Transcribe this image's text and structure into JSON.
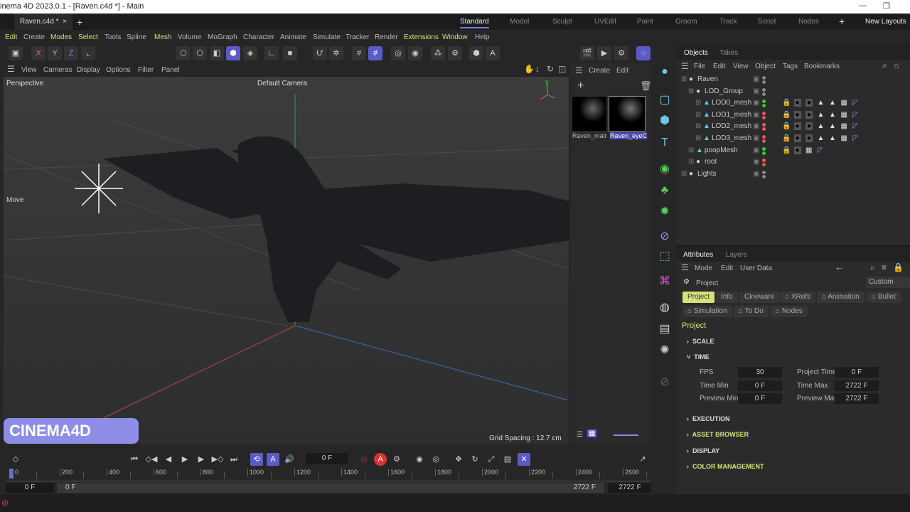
{
  "window": {
    "title": "inema 4D 2023.0.1 - [Raven.c4d *] - Main",
    "minimize": "—",
    "restore": "❐"
  },
  "tabs": {
    "doc": "Raven.c4d *",
    "close": "×",
    "add": "+"
  },
  "layouts": {
    "items": [
      "Standard",
      "Model",
      "Sculpt",
      "UVEdit",
      "Paint",
      "Groom",
      "Track",
      "Script",
      "Nodes"
    ],
    "add": "+",
    "new": "New Layouts"
  },
  "menu": [
    "Edit",
    "Create",
    "Modes",
    "Select",
    "Tools",
    "Spline",
    "Mesh",
    "Volume",
    "MoGraph",
    "Character",
    "Animate",
    "Simulate",
    "Tracker",
    "Render",
    "Extensions",
    "Window",
    "Help"
  ],
  "viewport": {
    "menu": [
      "View",
      "Cameras",
      "Display",
      "Options",
      "Filter",
      "Panel"
    ],
    "label": "Perspective",
    "camera": "Default Camera",
    "tool": "Move",
    "grid": "Grid Spacing : 12.7 cm",
    "logo": "CINEMA4D"
  },
  "materials": {
    "menu": [
      "Create",
      "Edit"
    ],
    "items": [
      "Raven_mair",
      "Raven_eyeC"
    ]
  },
  "objects": {
    "tabs": [
      "Objects",
      "Takes"
    ],
    "menu": [
      "File",
      "Edit",
      "View",
      "Object",
      "Tags",
      "Bookmarks"
    ],
    "rows": [
      {
        "name": "Raven",
        "depth": 0,
        "dots": [
          "#888",
          "#888"
        ]
      },
      {
        "name": "LOD_Group",
        "depth": 1,
        "dots": [
          "#888",
          "#888"
        ]
      },
      {
        "name": "LOD0_mesh",
        "depth": 2,
        "dots": [
          "#3c3",
          "#3c3"
        ]
      },
      {
        "name": "LOD1_mesh",
        "depth": 2,
        "dots": [
          "#e55",
          "#e55"
        ]
      },
      {
        "name": "LOD2_mesh",
        "depth": 2,
        "dots": [
          "#e55",
          "#e55"
        ]
      },
      {
        "name": "LOD3_mesh",
        "depth": 2,
        "dots": [
          "#e55",
          "#e55"
        ]
      },
      {
        "name": "poopMesh",
        "depth": 1,
        "dots": [
          "#3c3",
          "#3c3"
        ]
      },
      {
        "name": "root",
        "depth": 1,
        "dots": [
          "#e55",
          "#e55"
        ]
      },
      {
        "name": "Lights",
        "depth": 0,
        "dots": [
          "#888",
          "#888"
        ]
      }
    ]
  },
  "attributes": {
    "tabs": [
      "Attributes",
      "Layers"
    ],
    "menu": [
      "Mode",
      "Edit",
      "User Data"
    ],
    "object": "Project",
    "preset": "Custom",
    "ptabs": [
      "Project",
      "Info",
      "Cineware",
      "⌂ XRefs",
      "⌂ Animation",
      "⌂ Bullet",
      "⌂ Simulation",
      "⌂ To Do",
      "⌂ Nodes"
    ],
    "heading": "Project",
    "sections": [
      "SCALE",
      "TIME",
      "EXECUTION",
      "ASSET BROWSER",
      "DISPLAY",
      "COLOR MANAGEMENT"
    ],
    "fields": {
      "fps_label": "FPS",
      "fps": "30",
      "project_time_label": "Project Time",
      "project_time": "0 F",
      "time_min_label": "Time Min",
      "time_min": "0 F",
      "time_max_label": "Time Max",
      "time_max": "2722 F",
      "preview_min_label": "Preview Min",
      "preview_min": "0 F",
      "preview_max_label": "Preview Max",
      "preview_max": "2722 F"
    }
  },
  "timeline": {
    "current": "0 F",
    "ticks": [
      "0",
      "200",
      "400",
      "600",
      "800",
      "1000",
      "1200",
      "1400",
      "1600",
      "1800",
      "2000",
      "2200",
      "2400",
      "2600"
    ],
    "start": "0 F",
    "range_start": "0 F",
    "range_end": "2722 F",
    "end": "2722 F"
  }
}
